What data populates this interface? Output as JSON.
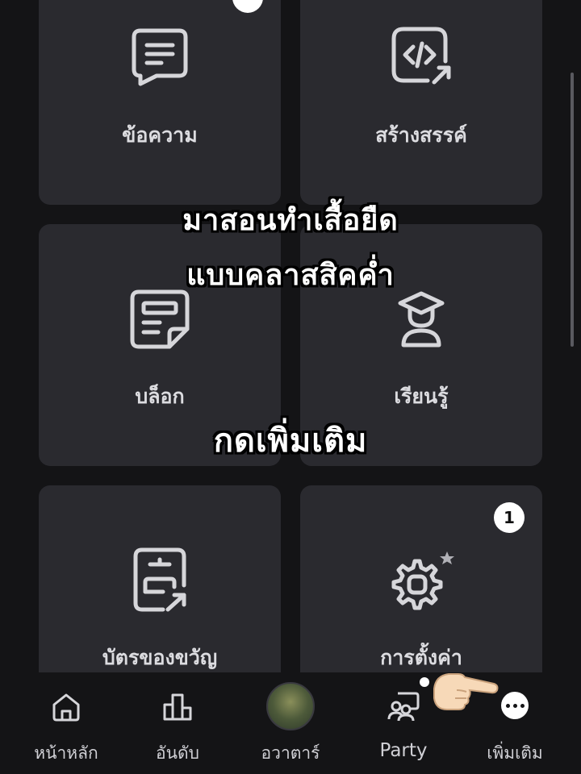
{
  "grid": {
    "cards": [
      {
        "label": "ข้อความ",
        "icon": "message-icon"
      },
      {
        "label": "สร้างสรรค์",
        "icon": "code-create-icon"
      },
      {
        "label": "บล็อก",
        "icon": "blog-icon"
      },
      {
        "label": "เรียนรู้",
        "icon": "learn-icon"
      },
      {
        "label": "บัตรของขวัญ",
        "icon": "gift-card-icon"
      },
      {
        "label": "การตั้งค่า",
        "icon": "settings-icon",
        "badge": "1"
      }
    ]
  },
  "overlay": {
    "line1": "มาสอนทำเสื้อยืด",
    "line2": "แบบคลาสสิคค่ำ",
    "line3": "กดเพิ่มเติม"
  },
  "nav": {
    "items": [
      {
        "label": "หน้าหลัก",
        "icon": "home-icon"
      },
      {
        "label": "อันดับ",
        "icon": "ranking-icon"
      },
      {
        "label": "อวาตาร์",
        "icon": "avatar"
      },
      {
        "label": "Party",
        "icon": "party-icon"
      },
      {
        "label": "เพิ่มเติม",
        "icon": "more-icon"
      }
    ]
  },
  "colors": {
    "background": "#141416",
    "card": "#2a2a2f",
    "icon": "#d6d6da",
    "badge": "#ffffff"
  }
}
